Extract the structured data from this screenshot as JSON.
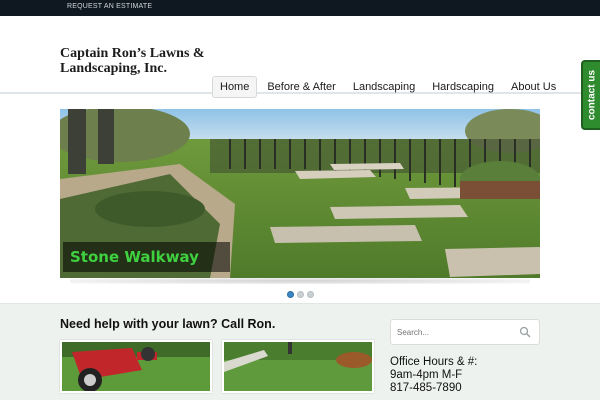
{
  "topbar": {
    "estimate_link": "REQUEST AN ESTIMATE"
  },
  "header": {
    "logo_line1": "Captain Ron’s Lawns &",
    "logo_line2": "Landscaping, Inc."
  },
  "nav": {
    "items": [
      {
        "label": "Home"
      },
      {
        "label": "Before & After"
      },
      {
        "label": "Landscaping"
      },
      {
        "label": "Hardscaping"
      },
      {
        "label": "About Us"
      }
    ],
    "active_index": 0
  },
  "contact_tab": {
    "label": "contact us"
  },
  "slider": {
    "caption": "Stone Walkway",
    "slide_count": 3,
    "active_slide": 1
  },
  "main": {
    "help_heading": "Need help with your lawn? Call Ron."
  },
  "sidebar": {
    "search_placeholder": "Search...",
    "office_line1": "Office Hours & #:",
    "office_line2": "9am-4pm M-F",
    "office_line3": "817-485-7890"
  },
  "colors": {
    "topbar": "#0f1720",
    "accent_green": "#2e8b2e",
    "caption_text": "#3fd13f",
    "active_dot": "#3a88c8"
  }
}
